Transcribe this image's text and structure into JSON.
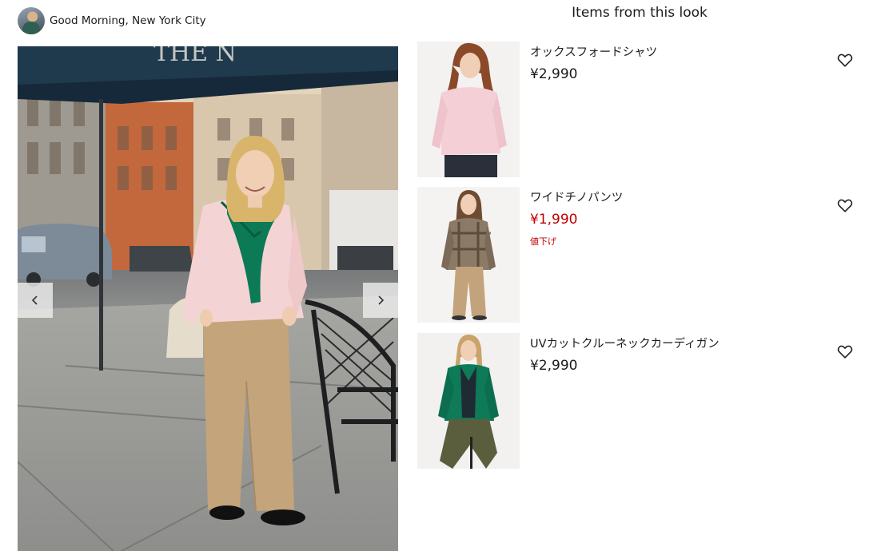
{
  "author": {
    "name": "Good Morning, New York City"
  },
  "section": {
    "title": "Items from this look"
  },
  "carousel": {
    "prev_label": "‹",
    "next_label": "›"
  },
  "products": [
    {
      "name": "オックスフォードシャツ",
      "price": "¥2,990",
      "sale": false,
      "badge": ""
    },
    {
      "name": "ワイドチノパンツ",
      "price": "¥1,990",
      "sale": true,
      "badge": "値下げ"
    },
    {
      "name": "UVカットクルーネックカーディガン",
      "price": "¥2,990",
      "sale": false,
      "badge": ""
    }
  ],
  "colors": {
    "sale_price": "#c00000",
    "text": "#1b1b1b"
  },
  "icons": {
    "favorite": "heart-outline-icon",
    "prev": "chevron-left-icon",
    "next": "chevron-right-icon"
  }
}
